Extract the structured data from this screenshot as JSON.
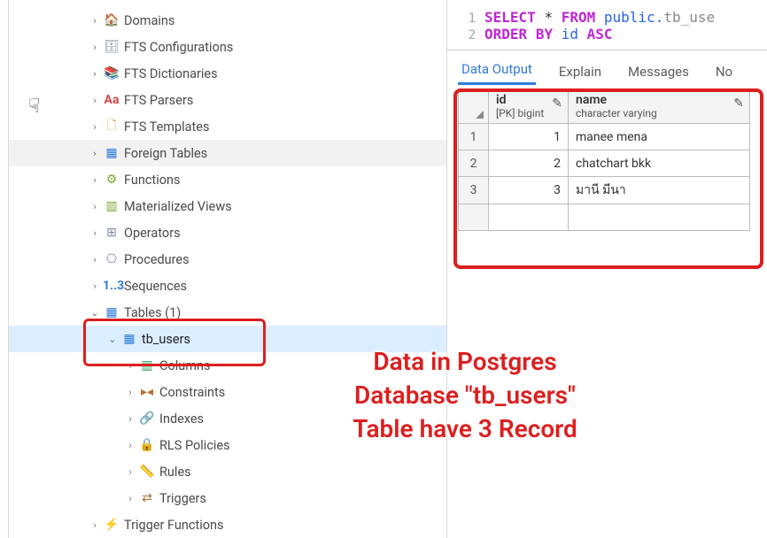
{
  "sidebar": {
    "items": [
      {
        "label": "Domains",
        "icon": "🏠",
        "iconClass": "ic-domains"
      },
      {
        "label": "FTS Configurations",
        "icon": "🗄",
        "iconClass": "ic-fts"
      },
      {
        "label": "FTS Dictionaries",
        "icon": "📚",
        "iconClass": "ic-fts"
      },
      {
        "label": "FTS Parsers",
        "icon": "Aa",
        "iconClass": "ic-aa"
      },
      {
        "label": "FTS Templates",
        "icon": "🗋",
        "iconClass": "ic-tpl"
      },
      {
        "label": "Foreign Tables",
        "icon": "▦",
        "iconClass": "ic-ft"
      },
      {
        "label": "Functions",
        "icon": "⚙",
        "iconClass": "ic-fn"
      },
      {
        "label": "Materialized Views",
        "icon": "▥",
        "iconClass": "ic-mv"
      },
      {
        "label": "Operators",
        "icon": "⊞",
        "iconClass": "ic-op"
      },
      {
        "label": "Procedures",
        "icon": "⎔",
        "iconClass": "ic-proc"
      },
      {
        "label": "Sequences",
        "icon": "1..3",
        "iconClass": "ic-seq"
      }
    ],
    "tables": {
      "label": "Tables (1)",
      "icon": "▦"
    },
    "table_item": {
      "label": "tb_users",
      "icon": "▦"
    },
    "table_children": [
      {
        "label": "Columns",
        "icon": "▥",
        "iconClass": "ic-col"
      },
      {
        "label": "Constraints",
        "icon": "▸◂",
        "iconClass": "ic-con"
      },
      {
        "label": "Indexes",
        "icon": "🔗",
        "iconClass": "ic-idx"
      },
      {
        "label": "RLS Policies",
        "icon": "🔒",
        "iconClass": "ic-rls"
      },
      {
        "label": "Rules",
        "icon": "📏",
        "iconClass": "ic-rule"
      },
      {
        "label": "Triggers",
        "icon": "⇄",
        "iconClass": "ic-trig"
      }
    ],
    "trigger_functions": {
      "label": "Trigger Functions",
      "icon": "⚡"
    }
  },
  "sql": {
    "line1": {
      "kw1": "SELECT",
      "star": "*",
      "kw2": "FROM",
      "schema": "public.",
      "table": "tb_use"
    },
    "line2": {
      "kw1": "ORDER",
      "kw2": "BY",
      "col": "id",
      "dir": "ASC"
    }
  },
  "tabs": [
    "Data Output",
    "Explain",
    "Messages",
    "No"
  ],
  "grid": {
    "cols": [
      {
        "title": "id",
        "type": "[PK] bigint"
      },
      {
        "title": "name",
        "type": "character varying"
      }
    ],
    "rows": [
      {
        "n": "1",
        "id": "1",
        "name": "manee mena"
      },
      {
        "n": "2",
        "id": "2",
        "name": "chatchart bkk"
      },
      {
        "n": "3",
        "id": "3",
        "name": "มานี มีนา"
      }
    ]
  },
  "annotation": "Data in Postgres Database \"tb_users\" Table have 3 Record"
}
